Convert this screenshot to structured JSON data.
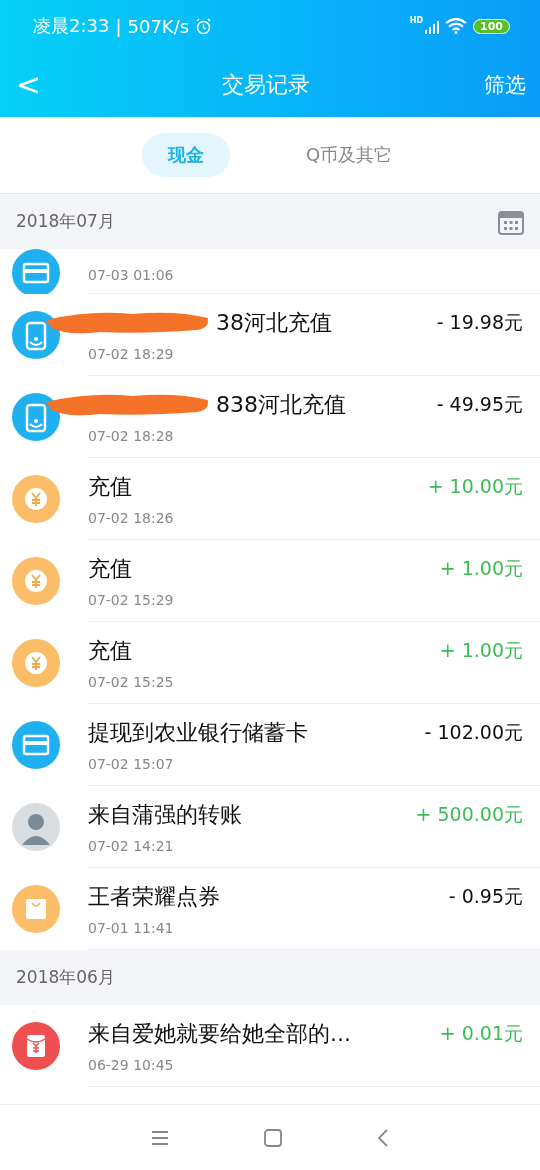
{
  "status_bar": {
    "time": "凌晨2:33",
    "separator": "|",
    "speed": "507K/s",
    "network": "HD",
    "battery": "100"
  },
  "header": {
    "back": "<",
    "title": "交易记录",
    "action": "筛选"
  },
  "tabs": [
    {
      "label": "现金",
      "selected": true
    },
    {
      "label": "Q币及其它",
      "selected": false
    }
  ],
  "groups": [
    {
      "month": "2018年07月",
      "calendar_button": true,
      "rows": [
        {
          "kind": "card",
          "partial": true,
          "time": "07-03 01:06"
        },
        {
          "kind": "phone",
          "title": "38河北充值",
          "redacted": true,
          "time": "07-02 18:29",
          "amount": "- 19.98元",
          "income": false
        },
        {
          "kind": "phone",
          "title": "838河北充值",
          "redacted": true,
          "time": "07-02 18:28",
          "amount": "- 49.95元",
          "income": false
        },
        {
          "kind": "coin",
          "title": "充值",
          "time": "07-02 18:26",
          "amount": "+ 10.00元",
          "income": true
        },
        {
          "kind": "coin",
          "title": "充值",
          "time": "07-02 15:29",
          "amount": "+ 1.00元",
          "income": true
        },
        {
          "kind": "coin",
          "title": "充值",
          "time": "07-02 15:25",
          "amount": "+ 1.00元",
          "income": true
        },
        {
          "kind": "card",
          "title": "提现到农业银行储蓄卡",
          "time": "07-02 15:07",
          "amount": "- 102.00元",
          "income": false
        },
        {
          "kind": "avatar",
          "title": "来自蒲强的转账",
          "time": "07-02 14:21",
          "amount": "+ 500.00元",
          "income": true
        },
        {
          "kind": "bag",
          "title": "王者荣耀点券",
          "time": "07-01 11:41",
          "amount": "- 0.95元",
          "income": false
        }
      ]
    },
    {
      "month": "2018年06月",
      "calendar_button": false,
      "rows": [
        {
          "kind": "redpacket",
          "title": "来自爱她就要给她全部的...",
          "time": "06-29 10:45",
          "amount": "+ 0.01元",
          "income": true
        }
      ]
    }
  ]
}
